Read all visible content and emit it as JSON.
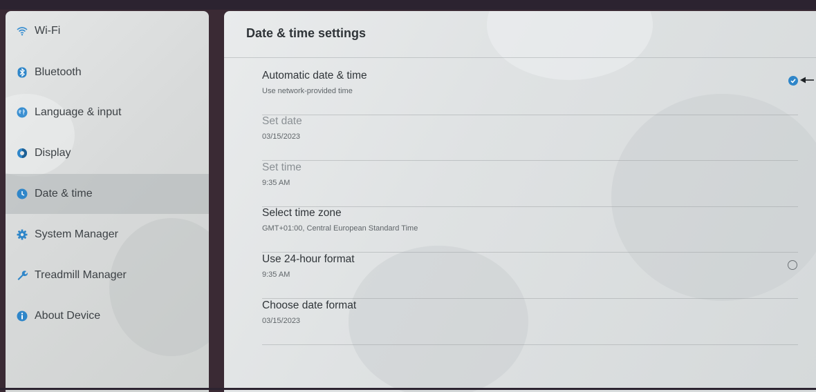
{
  "sidebar": {
    "items": [
      {
        "label": "Wi-Fi",
        "icon": "wifi-icon",
        "icon_color": "#3a8fd1"
      },
      {
        "label": "Bluetooth",
        "icon": "bluetooth-icon",
        "icon_color": "#2f86c9"
      },
      {
        "label": "Language & input",
        "icon": "globe-icon",
        "icon_color": "#3a8fd1"
      },
      {
        "label": "Display",
        "icon": "display-icon",
        "icon_color": "#2f86c9"
      },
      {
        "label": "Date & time",
        "icon": "clock-icon",
        "icon_color": "#2f86c9",
        "active": true
      },
      {
        "label": "System Manager",
        "icon": "gear-icon",
        "icon_color": "#2f86c9"
      },
      {
        "label": "Treadmill Manager",
        "icon": "wrench-icon",
        "icon_color": "#2f86c9"
      },
      {
        "label": "About Device",
        "icon": "info-icon",
        "icon_color": "#2f86c9"
      }
    ]
  },
  "main": {
    "title": "Date & time settings",
    "rows": [
      {
        "title": "Automatic date & time",
        "subtitle": "Use network-provided time",
        "control": "checkbox",
        "checked": true
      },
      {
        "title": "Set date",
        "subtitle": "03/15/2023",
        "disabled": true
      },
      {
        "title": "Set time",
        "subtitle": "9:35 AM",
        "disabled": true
      },
      {
        "title": "Select time zone",
        "subtitle": "GMT+01:00, Central European Standard Time"
      },
      {
        "title": "Use 24-hour format",
        "subtitle": "9:35 AM",
        "control": "radio",
        "checked": false
      },
      {
        "title": "Choose date format",
        "subtitle": "03/15/2023"
      }
    ]
  },
  "colors": {
    "accent": "#2f86c9",
    "text": "#2f3438",
    "disabled_text": "#8a9094"
  }
}
